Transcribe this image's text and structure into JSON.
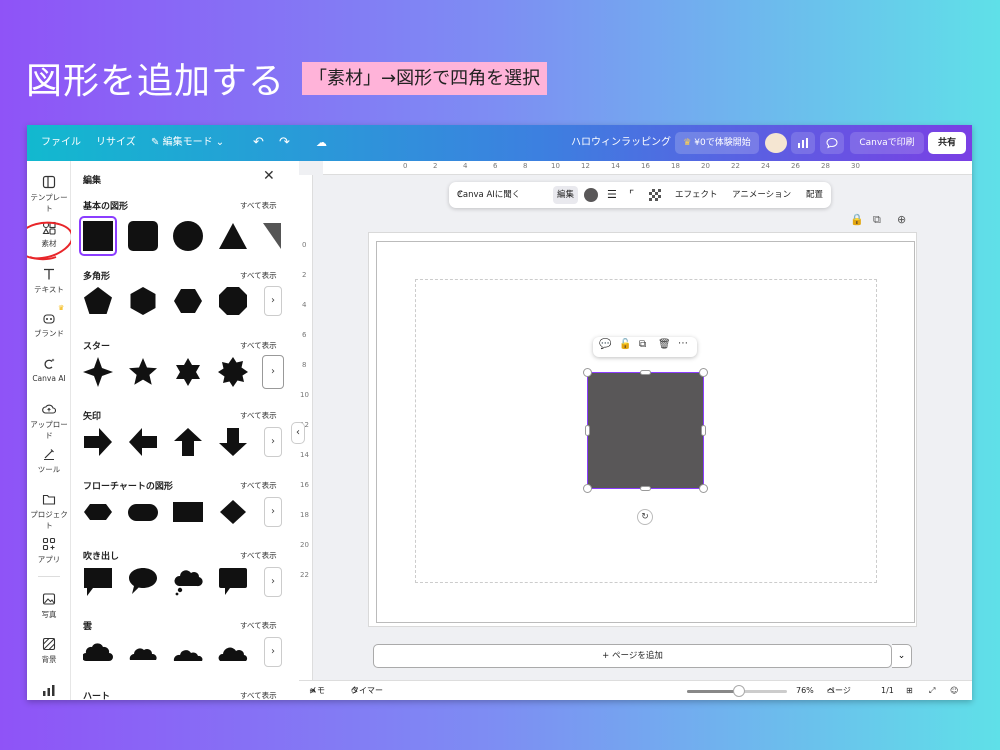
{
  "slide": {
    "title": "図形を追加する",
    "note": "「素材」→図形で四角を選択"
  },
  "topbar": {
    "file": "ファイル",
    "resize": "リサイズ",
    "edit_mode": "編集モード",
    "doc_title": "ハロウィンラッピング",
    "trial": "¥0で体験開始",
    "print": "Canvaで印刷",
    "share": "共有"
  },
  "rail": {
    "items": [
      {
        "label": "テンプレート",
        "icon": "template-icon"
      },
      {
        "label": "素材",
        "icon": "elements-icon"
      },
      {
        "label": "テキスト",
        "icon": "text-icon"
      },
      {
        "label": "ブランド",
        "icon": "brand-icon"
      },
      {
        "label": "Canva AI",
        "icon": "canva-ai-icon"
      },
      {
        "label": "アップロード",
        "icon": "upload-icon"
      },
      {
        "label": "ツール",
        "icon": "tools-icon"
      },
      {
        "label": "プロジェクト",
        "icon": "folder-icon"
      },
      {
        "label": "アプリ",
        "icon": "apps-icon"
      },
      {
        "label": "写真",
        "icon": "photo-icon"
      },
      {
        "label": "背景",
        "icon": "background-icon"
      }
    ]
  },
  "panel": {
    "header": "編集",
    "see_all": "すべて表示",
    "sections": [
      {
        "title": "基本の図形"
      },
      {
        "title": "多角形"
      },
      {
        "title": "スター"
      },
      {
        "title": "矢印"
      },
      {
        "title": "フローチャートの図形"
      },
      {
        "title": "吹き出し"
      },
      {
        "title": "雲"
      },
      {
        "title": "ハート"
      }
    ]
  },
  "ruler": {
    "top": [
      "0",
      "2",
      "4",
      "6",
      "8",
      "10",
      "12",
      "14",
      "16",
      "18",
      "20",
      "22",
      "24",
      "26",
      "28",
      "30"
    ],
    "left": [
      "0",
      "2",
      "4",
      "6",
      "8",
      "10",
      "12",
      "14",
      "16",
      "18",
      "20",
      "22"
    ]
  },
  "context_toolbar": {
    "ai": "Canva AIに聞く",
    "edit": "編集",
    "effects": "エフェクト",
    "animation": "アニメーション",
    "position": "配置"
  },
  "add_page": "+ ページを追加",
  "bottombar": {
    "notes": "メモ",
    "timer": "タイマー",
    "zoom": "76%",
    "pages_label": "ページ",
    "page_count": "1/1",
    "zoom_level": 0.76
  },
  "colors": {
    "accent": "#8b3dff",
    "shape_fill": "#595758",
    "annotation_circle": "#e8262a"
  }
}
